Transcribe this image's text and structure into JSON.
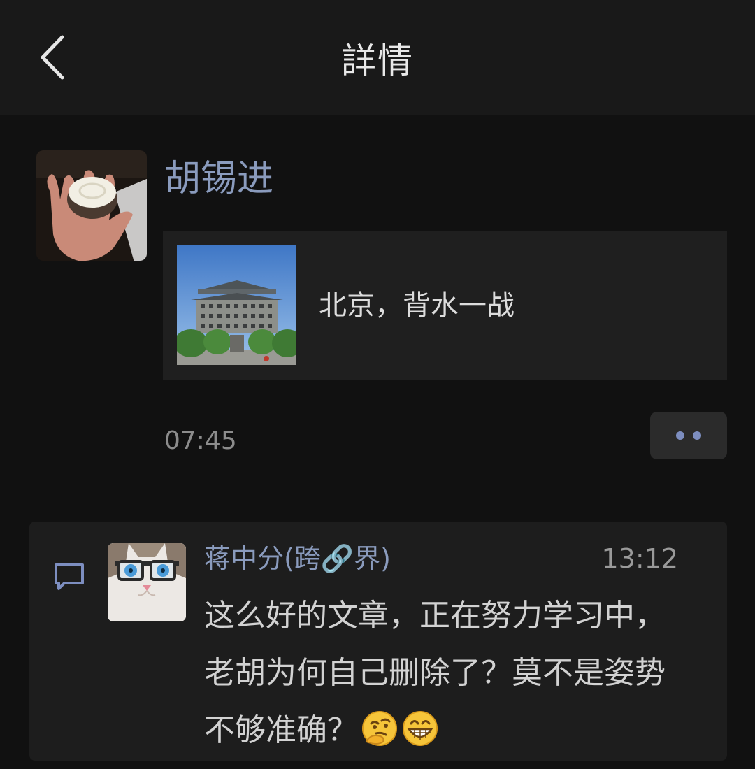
{
  "header": {
    "title": "詳情",
    "back_icon": "chevron-left-icon"
  },
  "post": {
    "author": "胡锡进",
    "link_title": "北京，背水一战",
    "time": "07:45",
    "more_icon": "more-dots-icon"
  },
  "comment": {
    "name": "蒋中分(跨🔗界)",
    "time": "13:12",
    "text": "这么好的文章，正在努力学习中，老胡为何自己删除了？莫不是姿势不够准确？",
    "emojis": [
      "thinking-face-icon",
      "grinning-face-icon"
    ]
  },
  "colors": {
    "background": "#111111",
    "header_bg": "#191919",
    "card_bg": "#1f1f1f",
    "name_blue": "#8a9bbd",
    "dots_blue": "#7d8ec0"
  }
}
